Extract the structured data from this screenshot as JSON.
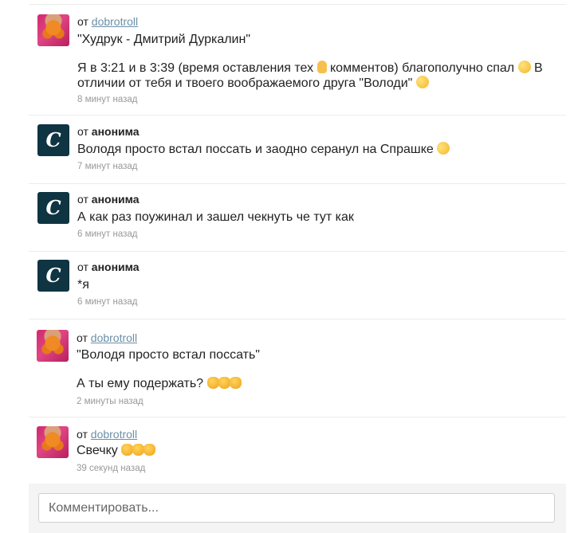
{
  "comments": [
    {
      "prefix": "от",
      "author": "dobrotroll",
      "author_type": "user",
      "lines": [
        "\"Худрук - Дмитрий Дуркалин\"",
        "",
        "Я в 3:21 и в 3:39 (время оставления тех",
        "комментов) благополучно спал",
        "В",
        "отличии от тебя и твоего воображаемого друга \"Володи\""
      ],
      "time": "8 минут назад"
    },
    {
      "prefix": "от",
      "author": "анонима",
      "author_type": "anonymous",
      "avatar_letter": "C",
      "text": "Володя просто встал поссать и заодно серанул на Спрашке",
      "time": "7 минут назад"
    },
    {
      "prefix": "от",
      "author": "анонима",
      "author_type": "anonymous",
      "avatar_letter": "C",
      "text": "А как раз поужинал и зашел чекнуть че тут как",
      "time": "6 минут назад"
    },
    {
      "prefix": "от",
      "author": "анонима",
      "author_type": "anonymous",
      "avatar_letter": "C",
      "text": "*я",
      "time": "6 минут назад"
    },
    {
      "prefix": "от",
      "author": "dobrotroll",
      "author_type": "user",
      "quote": "\"Володя просто встал поссать\"",
      "text": "А ты ему подержать?",
      "time": "2 минуты назад"
    },
    {
      "prefix": "от",
      "author": "dobrotroll",
      "author_type": "user",
      "text": "Свечку",
      "time": "39 секунд назад"
    }
  ],
  "composer": {
    "placeholder": "Комментировать..."
  },
  "icons": {
    "user_avatar": "avatar-photo",
    "anon_avatar": "spraashivai-logo-icon",
    "emoji_wink": "winking-face",
    "emoji_laugh": "rolling-laughing-face",
    "emoji_cat": "crying-laughing-cat-face",
    "emoji_point": "pointing-up-hand"
  }
}
